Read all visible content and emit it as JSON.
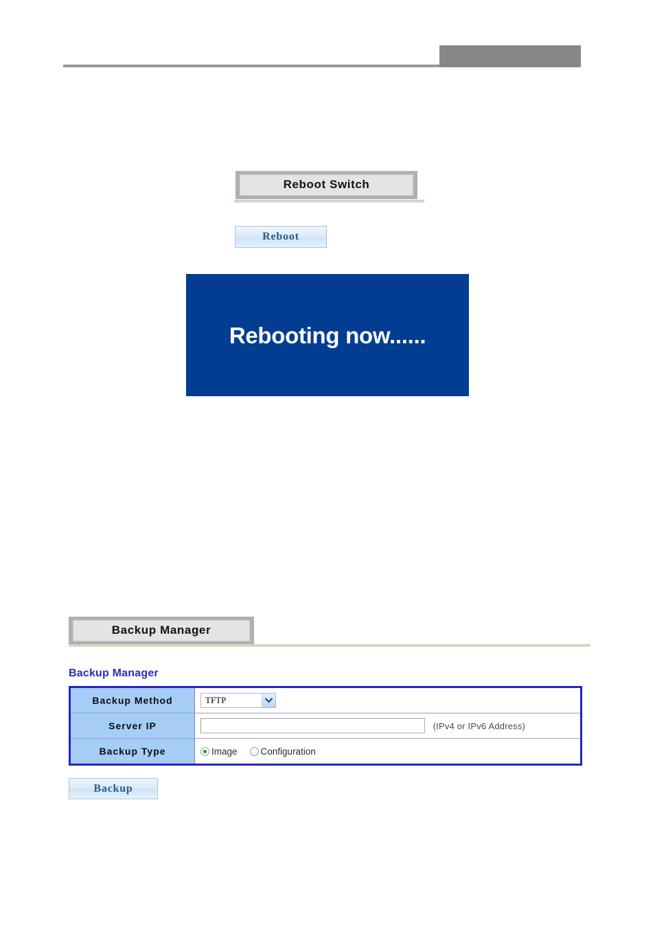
{
  "header": {
    "logo_placeholder": "",
    "rule": ""
  },
  "reboot_section": {
    "title": "Reboot Switch",
    "button_label": "Reboot",
    "status_panel": {
      "message": "Rebooting now......",
      "background_color": "#033d92",
      "text_color": "#ffffff"
    }
  },
  "backup_section": {
    "title": "Backup Manager",
    "heading": "Backup Manager",
    "heading_color": "#2b2bbd",
    "table": {
      "rows": [
        {
          "label": "Backup Method",
          "control": "select",
          "value": "TFTP",
          "options": [
            "TFTP"
          ]
        },
        {
          "label": "Server IP",
          "control": "text",
          "value": "",
          "placeholder": "",
          "hint": "(IPv4 or IPv6 Address)"
        },
        {
          "label": "Backup Type",
          "control": "radio",
          "options": [
            {
              "label": "Image",
              "checked": true
            },
            {
              "label": "Configuration",
              "checked": false
            }
          ]
        }
      ]
    },
    "button_label": "Backup"
  },
  "colors": {
    "table_border": "#2323c4",
    "label_cell": "#a6cdf5",
    "title_bar_outer": "#b0b0b0",
    "title_bar_inner": "#e4e4e4",
    "button_text": "#2a5d86"
  }
}
